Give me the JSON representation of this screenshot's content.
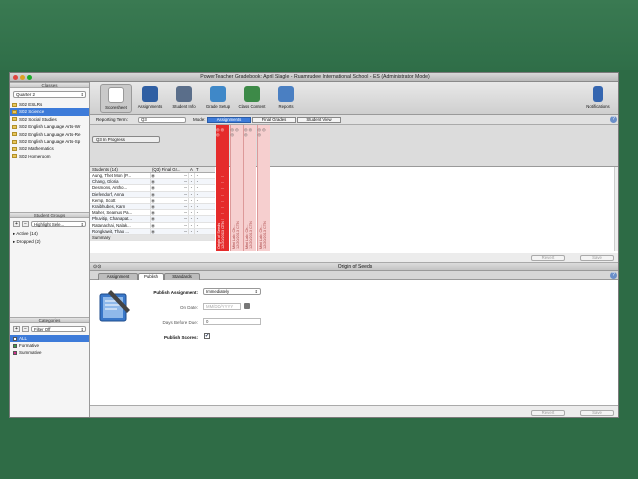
{
  "window": {
    "title": "PowerTeacher Gradebook: April Slagle - Ruamrudee International School - ES (Administrator Mode)"
  },
  "sidebar": {
    "classes_header": "Classes",
    "term": "Quarter 2",
    "classes": [
      {
        "label": "S02 ESLRs",
        "selected": false
      },
      {
        "label": "S02 Science",
        "selected": true
      },
      {
        "label": "S02 Social Studies",
        "selected": false
      },
      {
        "label": "S02 English Language Arts-Wr",
        "selected": false
      },
      {
        "label": "S02 English Language Arts-Re",
        "selected": false
      },
      {
        "label": "S02 English Language Arts-Sp",
        "selected": false
      },
      {
        "label": "S02 Mathematics",
        "selected": false
      },
      {
        "label": "S02 Homeroom",
        "selected": false
      }
    ],
    "student_groups_header": "Student Groups",
    "highlight_select": "Highlight Sele...",
    "groups": [
      "Active (14)",
      "Dropped (2)"
    ],
    "categories_header": "Categories",
    "filter_select": "Filter Off",
    "categories": [
      {
        "label": "ALL",
        "selected": true,
        "color": "#ffffff"
      },
      {
        "label": "Formative",
        "selected": false,
        "color": "#3aa04a"
      },
      {
        "label": "Summative",
        "selected": false,
        "color": "#d4318f"
      }
    ]
  },
  "toolbar": {
    "buttons": [
      {
        "label": "Scoresheet",
        "icon": "scoresheet-icon",
        "selected": true,
        "color": "#c9c9c9"
      },
      {
        "label": "Assignments",
        "icon": "assignments-icon",
        "selected": false,
        "color": "#2f5fa3"
      },
      {
        "label": "Student Info",
        "icon": "student-info-icon",
        "selected": false,
        "color": "#5a6e8a"
      },
      {
        "label": "Grade Setup",
        "icon": "grade-setup-icon",
        "selected": false,
        "color": "#3f88c8"
      },
      {
        "label": "Class Content",
        "icon": "class-content-icon",
        "selected": false,
        "color": "#3d8a48"
      },
      {
        "label": "Reports",
        "icon": "reports-icon",
        "selected": false,
        "color": "#4a7fc2"
      }
    ],
    "notifications_label": "Notifications"
  },
  "subbar": {
    "reporting_term_label": "Reporting Term:",
    "reporting_term_value": "Q3",
    "mode_label": "Mode:",
    "modes": [
      "Assignments",
      "Final Grades",
      "Student View"
    ]
  },
  "grid": {
    "in_progress": "Q3 In Progress",
    "headers": {
      "students": "Students (14)",
      "final": "(Q3) Final Gr...",
      "a": "A",
      "t": "T"
    },
    "students": [
      {
        "name": "Aung, Thet Mon (P...",
        "final": "--"
      },
      {
        "name": "Chang, Gloria",
        "final": "--"
      },
      {
        "name": "Desmons, Antho...",
        "final": "--"
      },
      {
        "name": "Diefendorf, Anna",
        "final": "--"
      },
      {
        "name": "Kemp, Scott",
        "final": "--"
      },
      {
        "name": "Kraibhubes, Karn",
        "final": "--"
      },
      {
        "name": "Maher, Seamus Pa...",
        "final": "--"
      },
      {
        "name": "Phuvitip, Chanapat...",
        "final": "--"
      },
      {
        "name": "Ratanachai, Nalak...",
        "final": "--"
      },
      {
        "name": "Rongkawit, Thao ...",
        "final": "--"
      }
    ],
    "summary_row": "Summary",
    "assignments": [
      {
        "title": "Origin of Seeds",
        "sub": "12/20/2013 CTN",
        "color": "#e52b2b"
      },
      {
        "title": "Mini Lab: Ch...",
        "sub": "12/20/2013 CTN",
        "color": "#f6cfcf"
      },
      {
        "title": "Mini Lab: Ch...",
        "sub": "12/20/2013 CTN",
        "color": "#f6cfcf"
      },
      {
        "title": "Mini Lab: Ch...",
        "sub": "12/20/2013 CTN",
        "color": "#f6cfcf"
      }
    ],
    "revert_label": "Revert",
    "save_label": "Save"
  },
  "panel": {
    "title": "Origin of Seeds",
    "tabs": [
      "Assignment",
      "Publish",
      "Standards"
    ],
    "active_tab": "Publish",
    "publish_assignment_label": "Publish Assignment:",
    "publish_assignment_value": "Immediately",
    "on_date_label": "On Date:",
    "on_date_placeholder": "MM/DD/YYYY",
    "days_before_label": "Days Before Due:",
    "days_before_value": "0",
    "publish_scores_label": "Publish Scores:",
    "publish_scores_checked": true,
    "revert_label": "Revert",
    "save_label": "Save"
  }
}
